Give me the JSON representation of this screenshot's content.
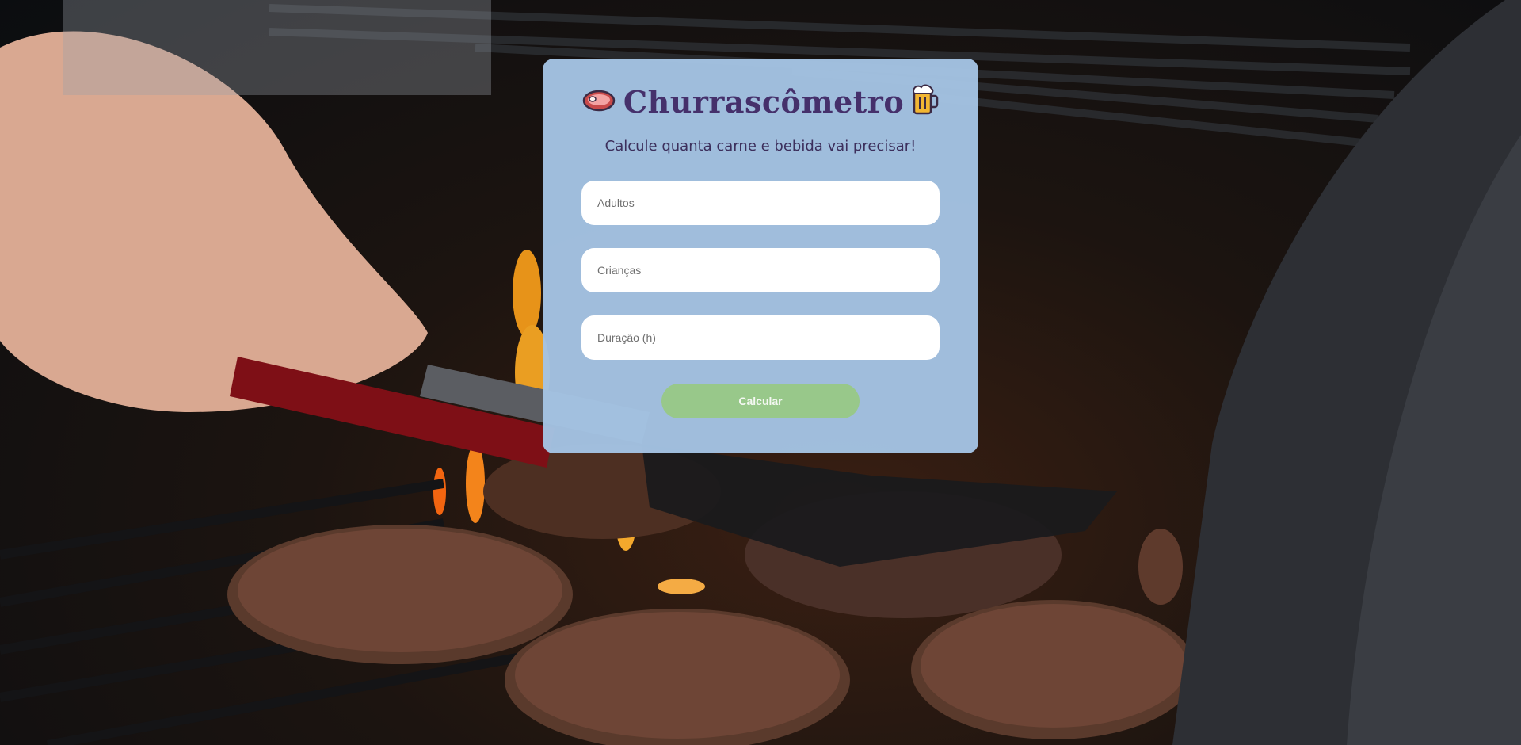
{
  "header": {
    "title": "Churrascômetro",
    "subtitle": "Calcule quanta carne e bebida vai precisar!",
    "left_icon": "meat-icon",
    "right_icon": "beer-mug-icon"
  },
  "form": {
    "adults_placeholder": "Adultos",
    "children_placeholder": "Crianças",
    "duration_placeholder": "Duração (h)",
    "adults_value": "",
    "children_value": "",
    "duration_value": "",
    "submit_label": "Calcular"
  },
  "colors": {
    "card_bg": "#a4c3e3",
    "title": "#45306b",
    "subtitle": "#3c2f5c",
    "button_bg": "#98c88a",
    "button_text": "#f4f8f2",
    "input_bg": "#ffffff"
  }
}
